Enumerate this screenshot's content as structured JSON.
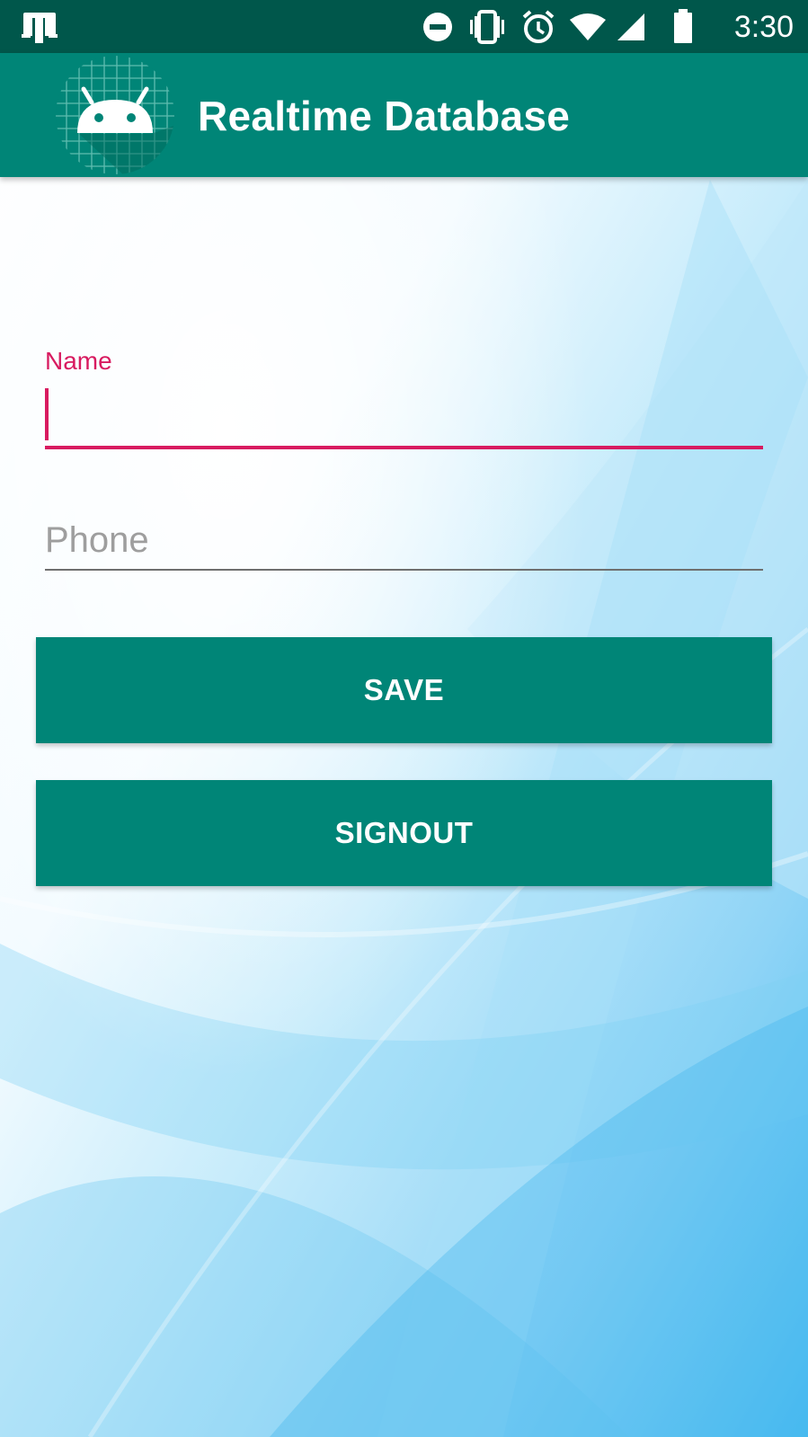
{
  "status_bar": {
    "time": "3:30",
    "icons": [
      "notification-app-icon",
      "do-not-disturb-icon",
      "vibrate-icon",
      "alarm-icon",
      "wifi-icon",
      "cellular-signal-icon",
      "battery-icon"
    ]
  },
  "app_bar": {
    "title": "Realtime Database",
    "logo_icon": "android-launcher-icon"
  },
  "form": {
    "name_label": "Name",
    "name_value": "",
    "phone_placeholder": "Phone",
    "phone_value": ""
  },
  "buttons": {
    "save_label": "SAVE",
    "signout_label": "SIGNOUT"
  },
  "colors": {
    "primary": "#008577",
    "primary_dark": "#00574b",
    "accent": "#d81b60"
  }
}
